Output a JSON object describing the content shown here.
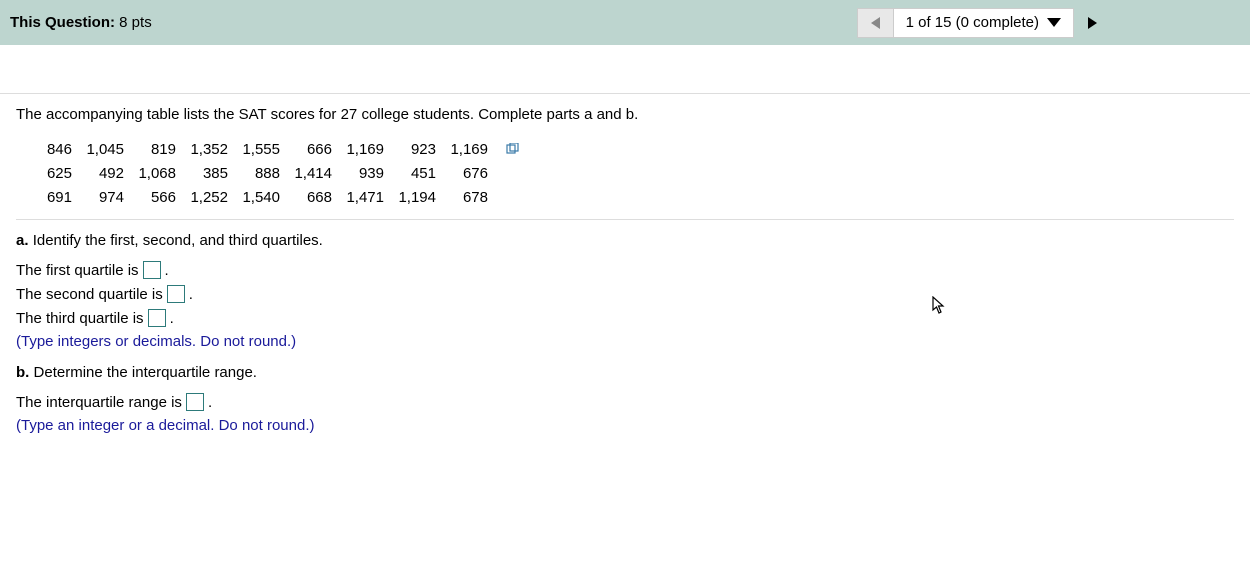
{
  "header": {
    "label_prefix": "This Question:",
    "points": "8 pts",
    "nav_text": "1 of 15 (0 complete)"
  },
  "question": {
    "intro": "The accompanying table lists the SAT scores for 27 college students. Complete parts a and b.",
    "data": [
      [
        "846",
        "1,045",
        "819",
        "1,352",
        "1,555",
        "666",
        "1,169",
        "923",
        "1,169"
      ],
      [
        "625",
        "492",
        "1,068",
        "385",
        "888",
        "1,414",
        "939",
        "451",
        "676"
      ],
      [
        "691",
        "974",
        "566",
        "1,252",
        "1,540",
        "668",
        "1,471",
        "1,194",
        "678"
      ]
    ],
    "part_a": {
      "label": "a.",
      "text": "Identify the first, second, and third quartiles.",
      "line1_pre": "The first quartile is",
      "line2_pre": "The second quartile is",
      "line3_pre": "The third quartile is",
      "period": ".",
      "hint": "(Type integers or decimals. Do not round.)"
    },
    "part_b": {
      "label": "b.",
      "text": "Determine the interquartile range.",
      "line1_pre": "The interquartile range is",
      "period": ".",
      "hint": "(Type an integer or a decimal. Do not round.)"
    }
  }
}
